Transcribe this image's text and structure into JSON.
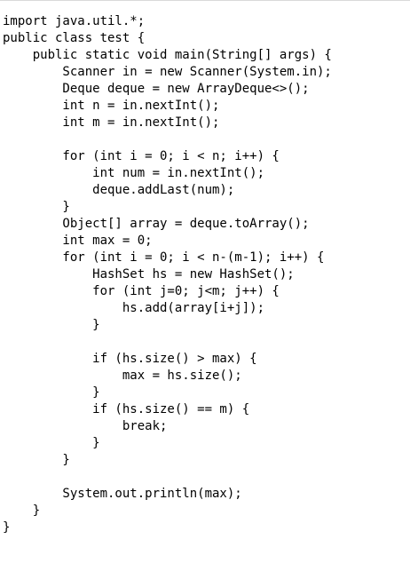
{
  "code_lines": [
    "import java.util.*;",
    "public class test {",
    "    public static void main(String[] args) {",
    "        Scanner in = new Scanner(System.in);",
    "        Deque deque = new ArrayDeque<>();",
    "        int n = in.nextInt();",
    "        int m = in.nextInt();",
    "",
    "        for (int i = 0; i < n; i++) {",
    "            int num = in.nextInt();",
    "            deque.addLast(num);",
    "        }",
    "        Object[] array = deque.toArray();",
    "        int max = 0;",
    "        for (int i = 0; i < n-(m-1); i++) {",
    "            HashSet hs = new HashSet();",
    "            for (int j=0; j<m; j++) {",
    "                hs.add(array[i+j]);",
    "            }",
    "",
    "            if (hs.size() > max) {",
    "                max = hs.size();",
    "            }",
    "            if (hs.size() == m) {",
    "                break;",
    "            }",
    "        }",
    "",
    "        System.out.println(max);",
    "    }",
    "}"
  ]
}
